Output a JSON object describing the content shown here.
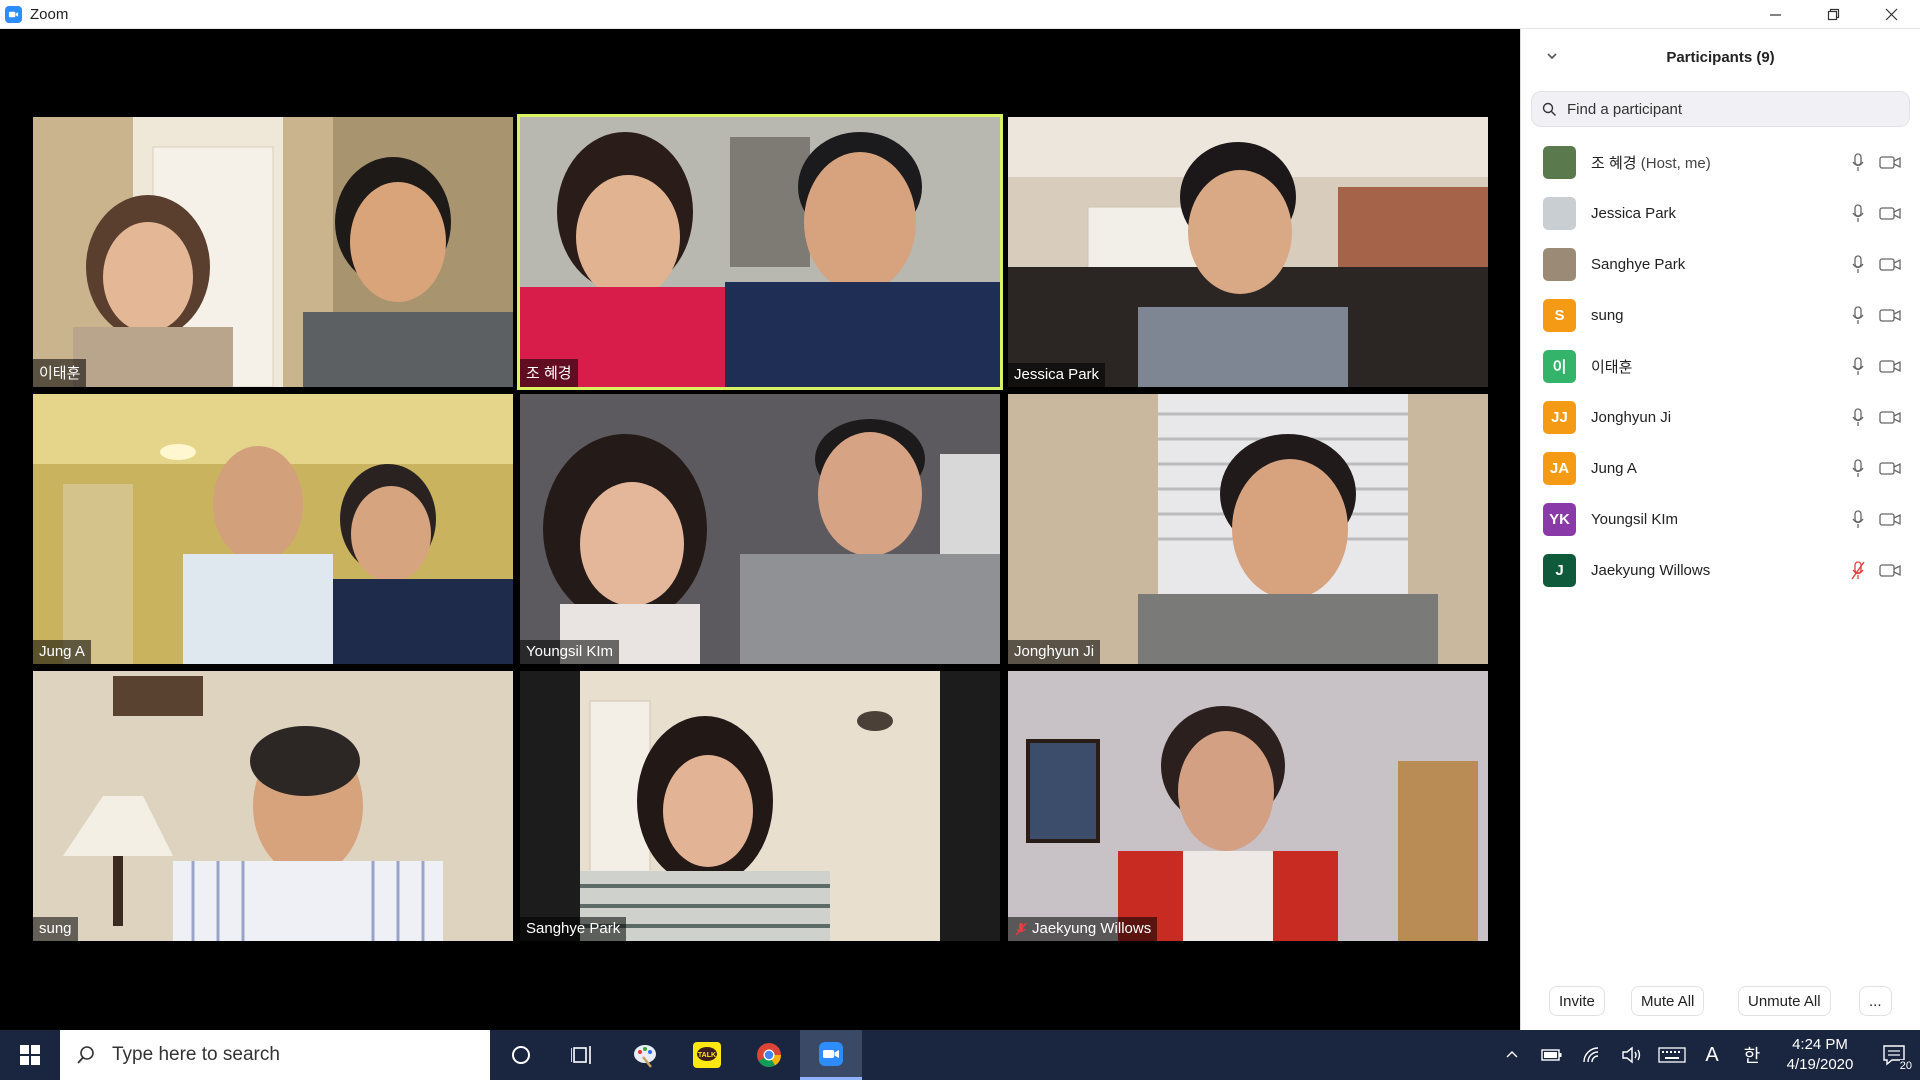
{
  "window": {
    "title": "Zoom",
    "minimize_icon": "minimize-icon",
    "restore_icon": "restore-icon",
    "close_icon": "close-icon"
  },
  "gallery": {
    "active_speaker_color": "#d9f264",
    "tiles": [
      {
        "name": "이태훈",
        "muted": false
      },
      {
        "name": "조 혜경",
        "muted": false,
        "active": true
      },
      {
        "name": "Jessica Park",
        "muted": false
      },
      {
        "name": "Jung A",
        "muted": false
      },
      {
        "name": "Youngsil KIm",
        "muted": false
      },
      {
        "name": "Jonghyun Ji",
        "muted": false
      },
      {
        "name": "sung",
        "muted": false
      },
      {
        "name": "Sanghye Park",
        "muted": false
      },
      {
        "name": "Jaekyung Willows",
        "muted": true
      }
    ]
  },
  "participants": {
    "title": "Participants (9)",
    "search_placeholder": "Find a participant",
    "list": [
      {
        "name": "조 혜경",
        "role": "(Host, me)",
        "avatar_text": "",
        "avatar_color": "#5a7a4e",
        "muted": false
      },
      {
        "name": "Jessica Park",
        "role": "",
        "avatar_text": "",
        "avatar_color": "#c9ced3",
        "muted": false
      },
      {
        "name": "Sanghye Park",
        "role": "",
        "avatar_text": "",
        "avatar_color": "#9b8a76",
        "muted": false
      },
      {
        "name": "sung",
        "role": "",
        "avatar_text": "S",
        "avatar_color": "#f59a14",
        "muted": false
      },
      {
        "name": "이태훈",
        "role": "",
        "avatar_text": "이",
        "avatar_color": "#34b36b",
        "muted": false
      },
      {
        "name": "Jonghyun Ji",
        "role": "",
        "avatar_text": "JJ",
        "avatar_color": "#f59a14",
        "muted": false
      },
      {
        "name": "Jung A",
        "role": "",
        "avatar_text": "JA",
        "avatar_color": "#f59a14",
        "muted": false
      },
      {
        "name": "Youngsil KIm",
        "role": "",
        "avatar_text": "YK",
        "avatar_color": "#8a3aa8",
        "muted": false
      },
      {
        "name": "Jaekyung Willows",
        "role": "",
        "avatar_text": "J",
        "avatar_color": "#0f5a3a",
        "muted": true
      }
    ],
    "buttons": {
      "invite": "Invite",
      "mute_all": "Mute All",
      "unmute_all": "Unmute All",
      "more": "..."
    }
  },
  "taskbar": {
    "search_placeholder": "Type here to search",
    "time": "4:24 PM",
    "date": "4/19/2020",
    "notification_count": "20",
    "ime_mode": "A",
    "ime_lang": "한",
    "apps": [
      "cortana-icon",
      "task-view-icon",
      "paint-icon",
      "kakaotalk-icon",
      "chrome-icon",
      "zoom-icon"
    ]
  }
}
